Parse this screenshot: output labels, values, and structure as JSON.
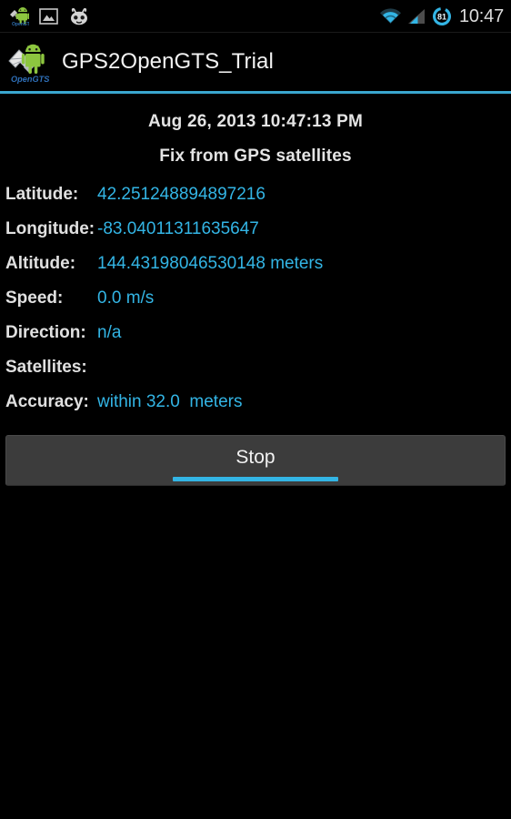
{
  "statusbar": {
    "left_icons": [
      {
        "name": "gps2opengts-notification-icon",
        "label": "GPS2OpenGTS notification"
      },
      {
        "name": "gallery-image-icon",
        "label": "Image / screenshot notification"
      },
      {
        "name": "cyanogenmod-icon",
        "label": "CyanogenMod"
      }
    ],
    "wifi_icon": "wifi-icon",
    "signal_icon": "cellular-signal-icon",
    "battery_icon": "battery-icon",
    "battery_level": "81",
    "clock": "10:47"
  },
  "actionbar": {
    "app_icon": "app-logo-icon",
    "app_icon_caption": "OpenGTS",
    "title": "GPS2OpenGTS_Trial",
    "accent_color": "#3aa7cf"
  },
  "main": {
    "timestamp": "Aug 26, 2013 10:47:13 PM",
    "fix_status": "Fix from GPS satellites",
    "fields": [
      {
        "label": "Latitude:",
        "value": "42.251248894897216"
      },
      {
        "label": "Longitude:",
        "value": "-83.04011311635647"
      },
      {
        "label": "Altitude:",
        "value": "144.43198046530148 meters"
      },
      {
        "label": "Speed:",
        "value": "0.0 m/s"
      },
      {
        "label": "Direction:",
        "value": "n/a"
      },
      {
        "label": "Satellites:",
        "value": ""
      },
      {
        "label": "Accuracy:",
        "value": "within 32.0  meters"
      }
    ],
    "value_color": "#33b5e5",
    "label_color": "#e0e0e0"
  },
  "button": {
    "label": "Stop",
    "focus_color": "#33b5e5",
    "background_color": "#3c3c3c"
  }
}
